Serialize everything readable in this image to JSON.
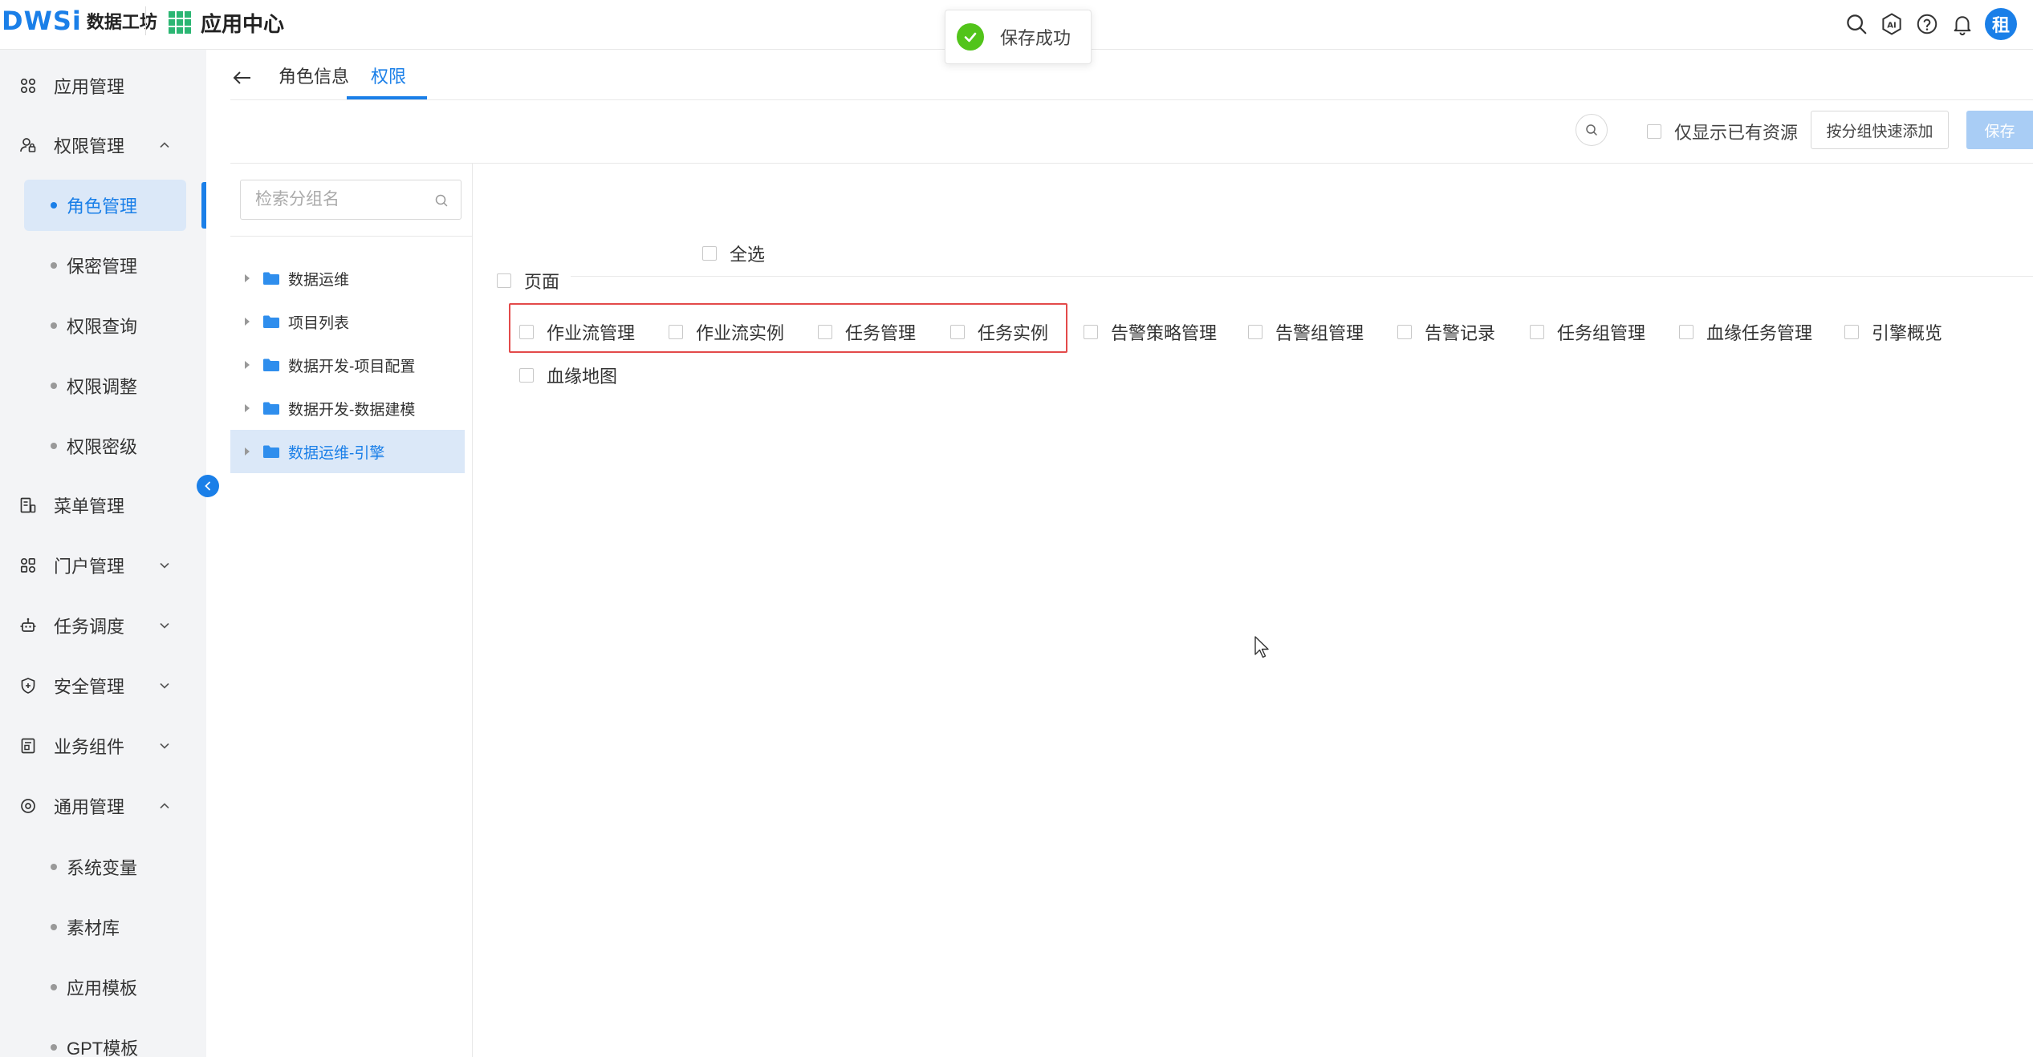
{
  "header": {
    "logo_mark": "DWSi",
    "logo_text": "数据工坊",
    "app_center": "应用中心",
    "avatar_text": "租",
    "icons": [
      "search-icon",
      "ai-icon",
      "help-icon",
      "bell-icon"
    ]
  },
  "toast": {
    "text": "保存成功",
    "icon": "check-circle-icon"
  },
  "sidebar": {
    "items": [
      {
        "label": "应用管理",
        "icon": "apps-icon"
      },
      {
        "label": "权限管理",
        "icon": "user-lock-icon",
        "expanded": true,
        "children": [
          {
            "label": "角色管理",
            "active": true
          },
          {
            "label": "保密管理"
          },
          {
            "label": "权限查询"
          },
          {
            "label": "权限调整"
          },
          {
            "label": "权限密级"
          }
        ]
      },
      {
        "label": "菜单管理",
        "icon": "menu-icon"
      },
      {
        "label": "门户管理",
        "icon": "portal-icon",
        "expanded": false
      },
      {
        "label": "任务调度",
        "icon": "robot-icon",
        "expanded": false
      },
      {
        "label": "安全管理",
        "icon": "shield-icon",
        "expanded": false
      },
      {
        "label": "业务组件",
        "icon": "component-icon",
        "expanded": false
      },
      {
        "label": "通用管理",
        "icon": "settings-icon",
        "expanded": true,
        "children": [
          {
            "label": "系统变量"
          },
          {
            "label": "素材库"
          },
          {
            "label": "应用模板"
          },
          {
            "label": "GPT模板"
          }
        ]
      }
    ]
  },
  "tabs": [
    {
      "label": "角色信息",
      "active": false
    },
    {
      "label": "权限",
      "active": true
    }
  ],
  "toolbar": {
    "only_existing_label": "仅显示已有资源",
    "quick_add_label": "按分组快速添加",
    "save_label": "保存"
  },
  "tree": {
    "search_placeholder": "检索分组名",
    "nodes": [
      {
        "label": "数据运维",
        "active": false
      },
      {
        "label": "项目列表",
        "active": false
      },
      {
        "label": "数据开发-项目配置",
        "active": false
      },
      {
        "label": "数据开发-数据建模",
        "active": false
      },
      {
        "label": "数据运维-引擎",
        "active": true
      }
    ]
  },
  "permissions": {
    "select_all_label": "全选",
    "section_label": "页面",
    "items": [
      {
        "label": "作业流管理",
        "checked": false
      },
      {
        "label": "作业流实例",
        "checked": false
      },
      {
        "label": "任务管理",
        "checked": false
      },
      {
        "label": "任务实例",
        "checked": false
      },
      {
        "label": "告警策略管理",
        "checked": false
      },
      {
        "label": "告警组管理",
        "checked": false
      },
      {
        "label": "告警记录",
        "checked": false
      },
      {
        "label": "任务组管理",
        "checked": false
      },
      {
        "label": "血缘任务管理",
        "checked": false
      },
      {
        "label": "引擎概览",
        "checked": false
      },
      {
        "label": "血缘地图",
        "checked": false
      }
    ]
  },
  "colors": {
    "primary": "#1a7fe8",
    "success": "#52c41a",
    "highlight_border": "#e34a4a",
    "sidebar_bg": "#f3f4f6",
    "active_bg": "#dbe8f8"
  }
}
